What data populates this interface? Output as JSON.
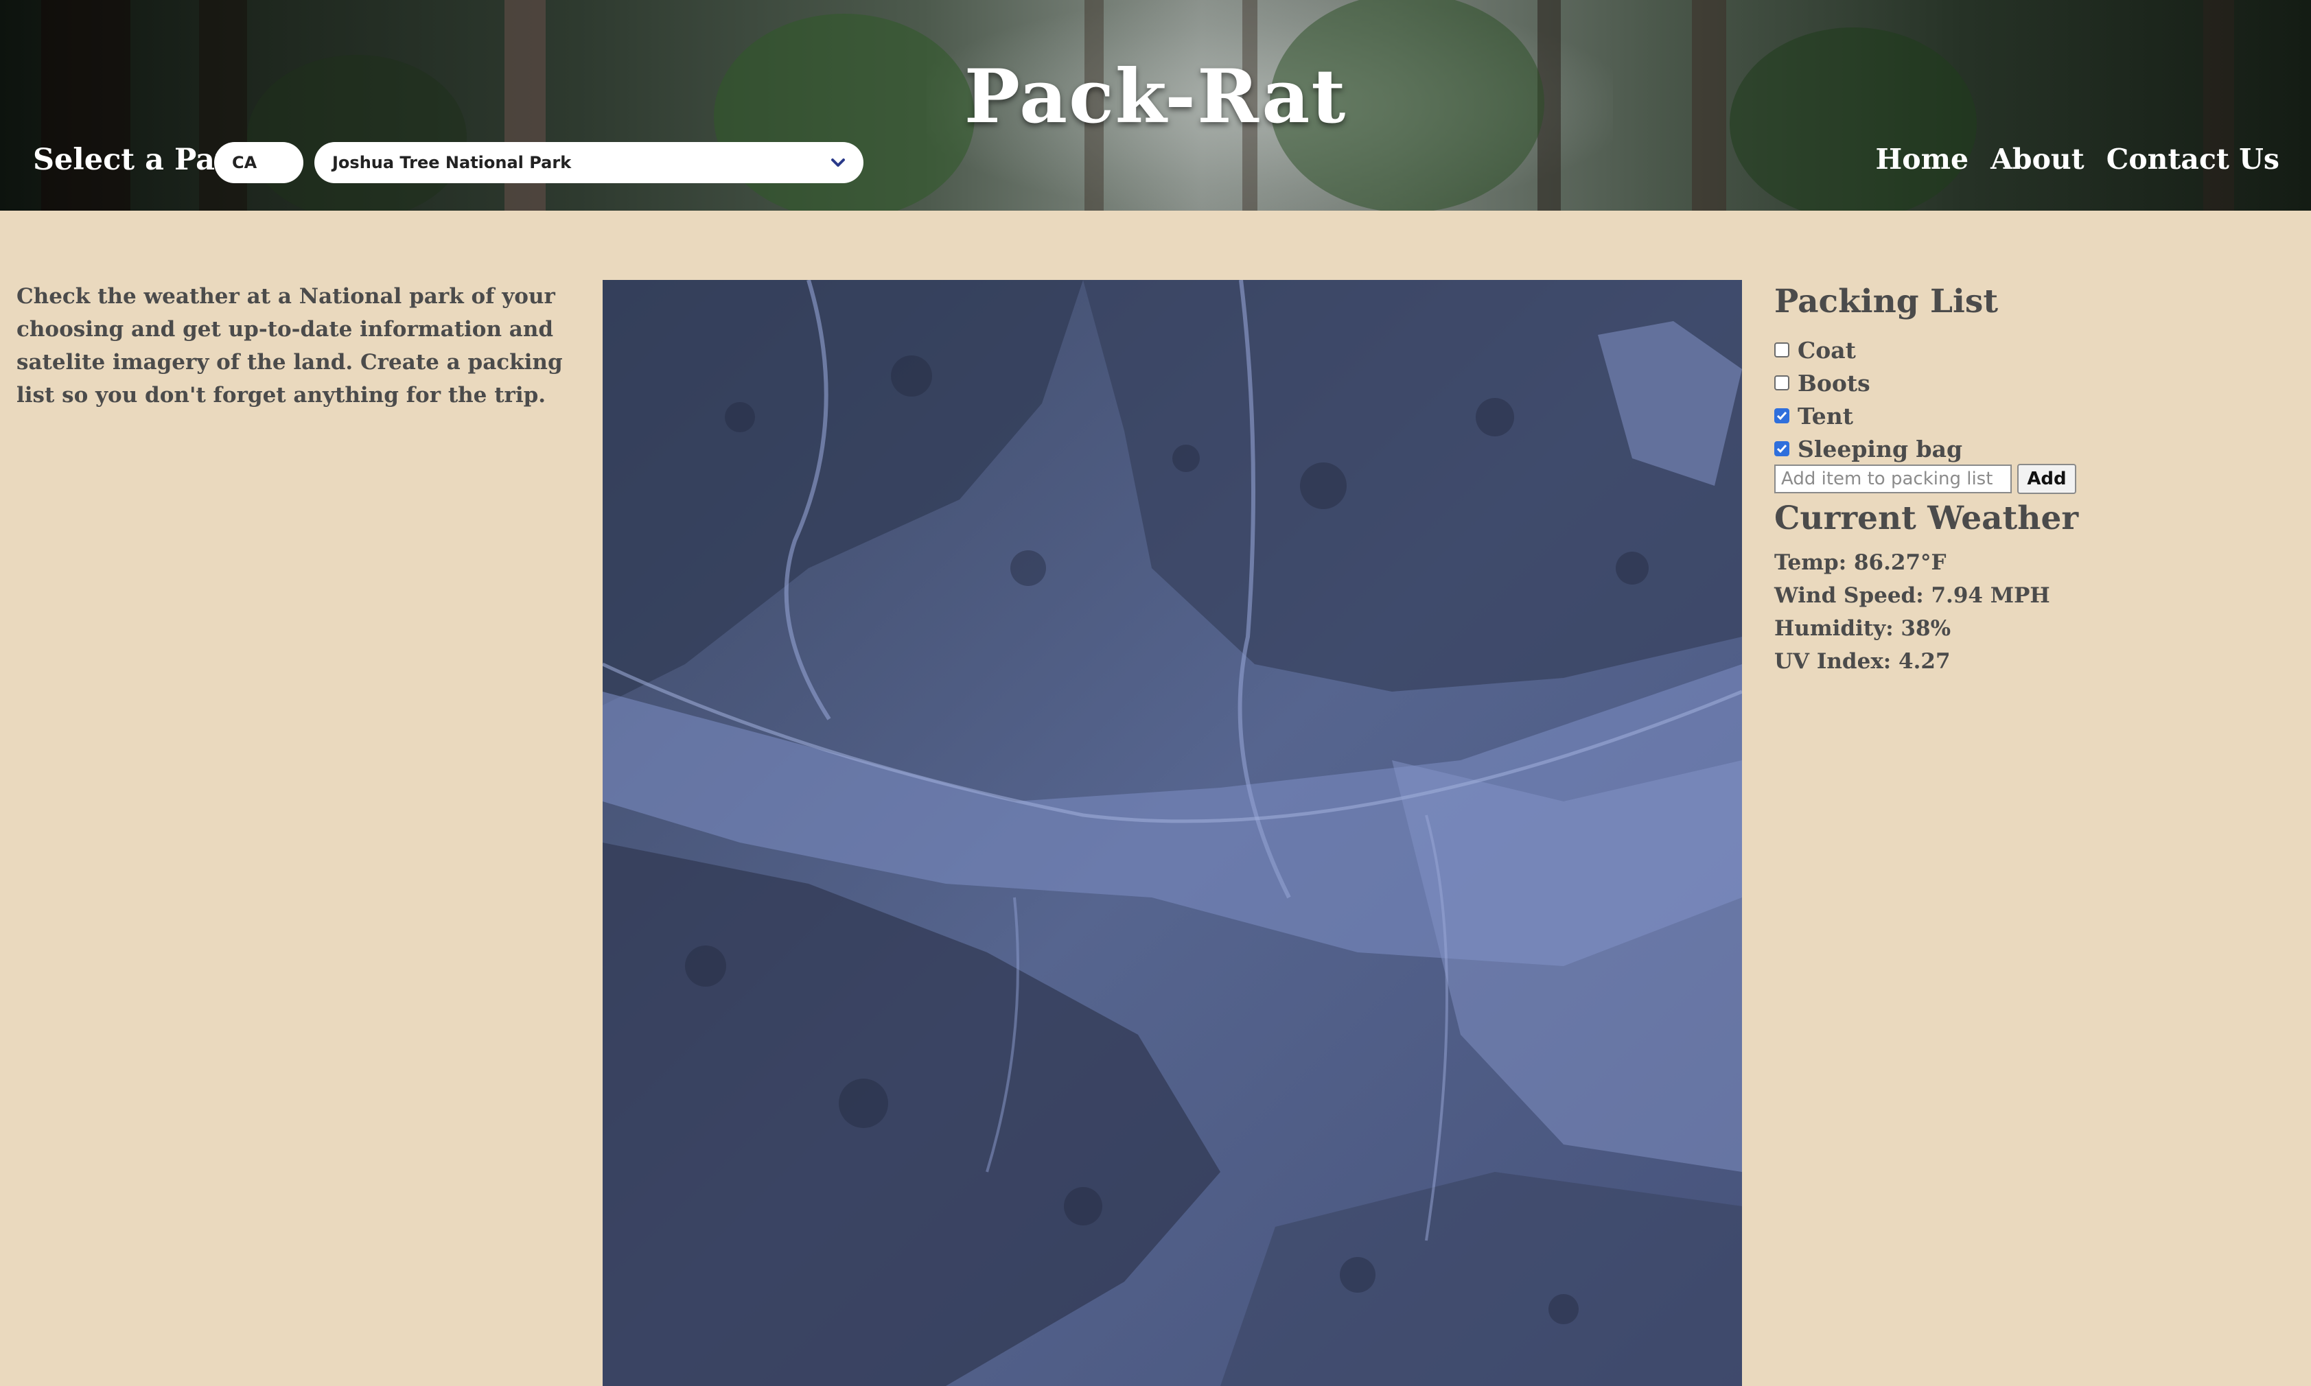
{
  "header": {
    "title": "Pack-Rat",
    "park_label": "Select a Park",
    "state_value": "CA",
    "park_value": "Joshua Tree National Park",
    "nav": [
      "Home",
      "About",
      "Contact Us"
    ]
  },
  "intro": {
    "text": "Check the weather at a National park of your choosing and get up-to-date information and satelite imagery of the land. Create a packing list so you don't forget anything for the trip."
  },
  "packing": {
    "title": "Packing List",
    "items": [
      {
        "label": "Coat",
        "checked": false
      },
      {
        "label": "Boots",
        "checked": false
      },
      {
        "label": "Tent",
        "checked": true
      },
      {
        "label": "Sleeping bag",
        "checked": true
      }
    ],
    "input_placeholder": "Add item to packing list",
    "add_label": "Add"
  },
  "weather": {
    "title": "Current Weather",
    "temp": "Temp: 86.27°F",
    "wind": "Wind Speed: 7.94 MPH",
    "humidity": "Humidity: 38%",
    "uv": "UV Index: 4.27"
  },
  "colors": {
    "page_bg": "#ead9be",
    "text": "#4b4b4b",
    "checkbox_accent": "#2f6fdc",
    "satellite_tint": "#5a6a93"
  }
}
